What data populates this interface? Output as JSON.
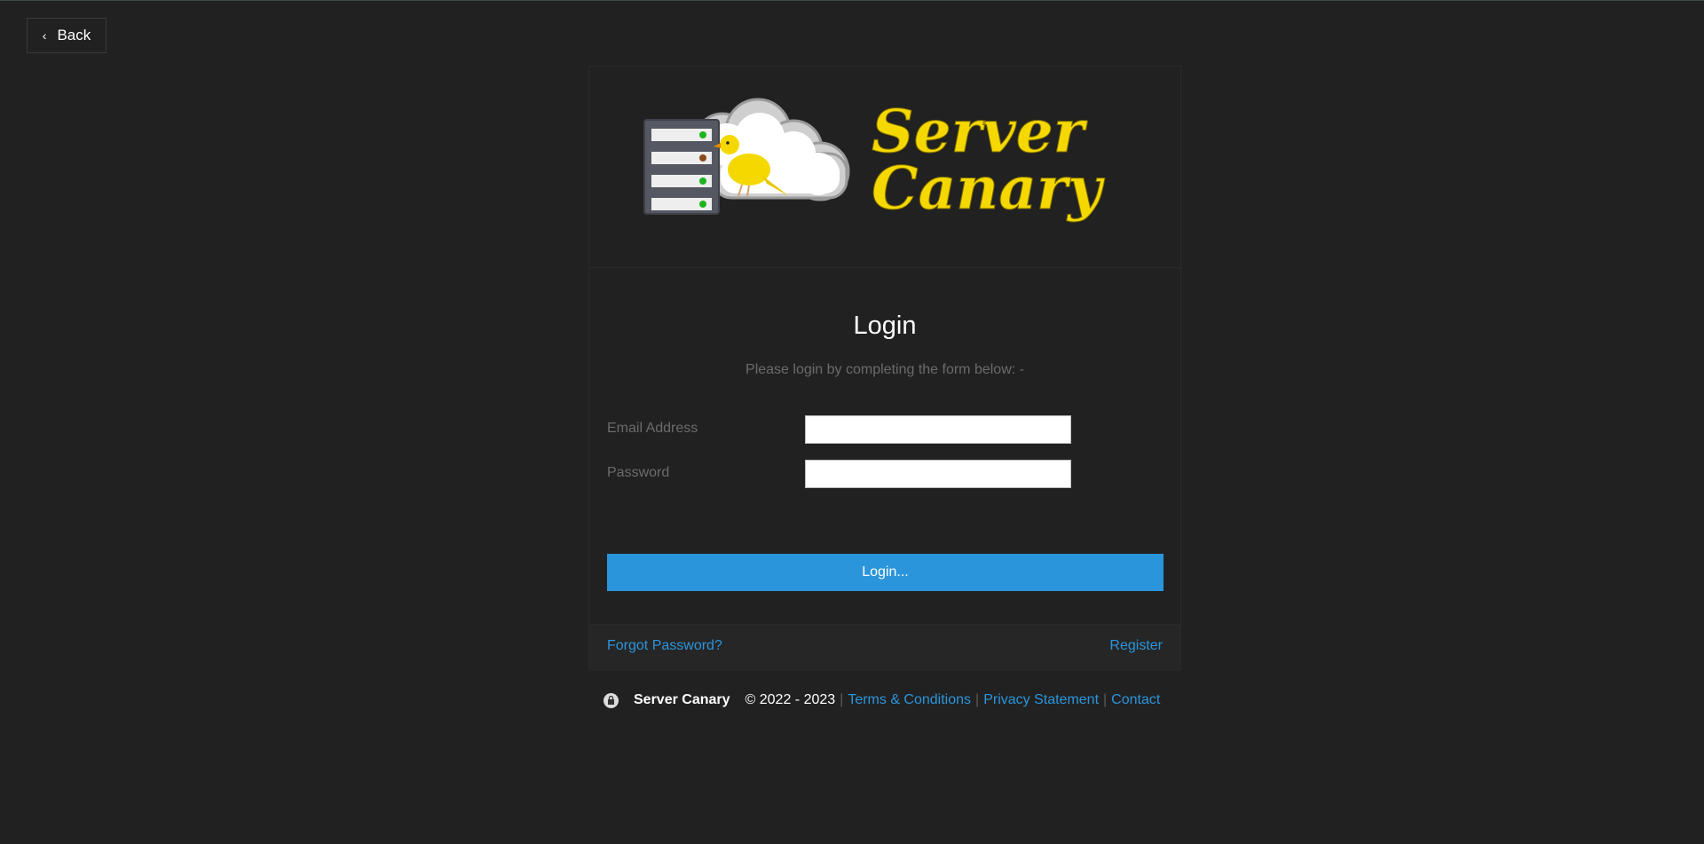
{
  "nav": {
    "back_label": "Back"
  },
  "logo": {
    "line1": "Server",
    "line2": "Canary"
  },
  "login": {
    "title": "Login",
    "subtitle": "Please login by completing the form below: -",
    "email_label": "Email Address",
    "email_value": "",
    "password_label": "Password",
    "password_value": "",
    "submit_label": "Login..."
  },
  "card_footer": {
    "forgot_label": "Forgot Password?",
    "register_label": "Register"
  },
  "footer": {
    "brand": "Server Canary",
    "copyright": "© 2022 - 2023",
    "separator": "|",
    "terms_label": "Terms & Conditions",
    "privacy_label": "Privacy Statement",
    "contact_label": "Contact"
  },
  "colors": {
    "background": "#212121",
    "accent": "#2b95dc",
    "logo_yellow": "#f5d800",
    "muted_text": "#6b6b6b"
  }
}
